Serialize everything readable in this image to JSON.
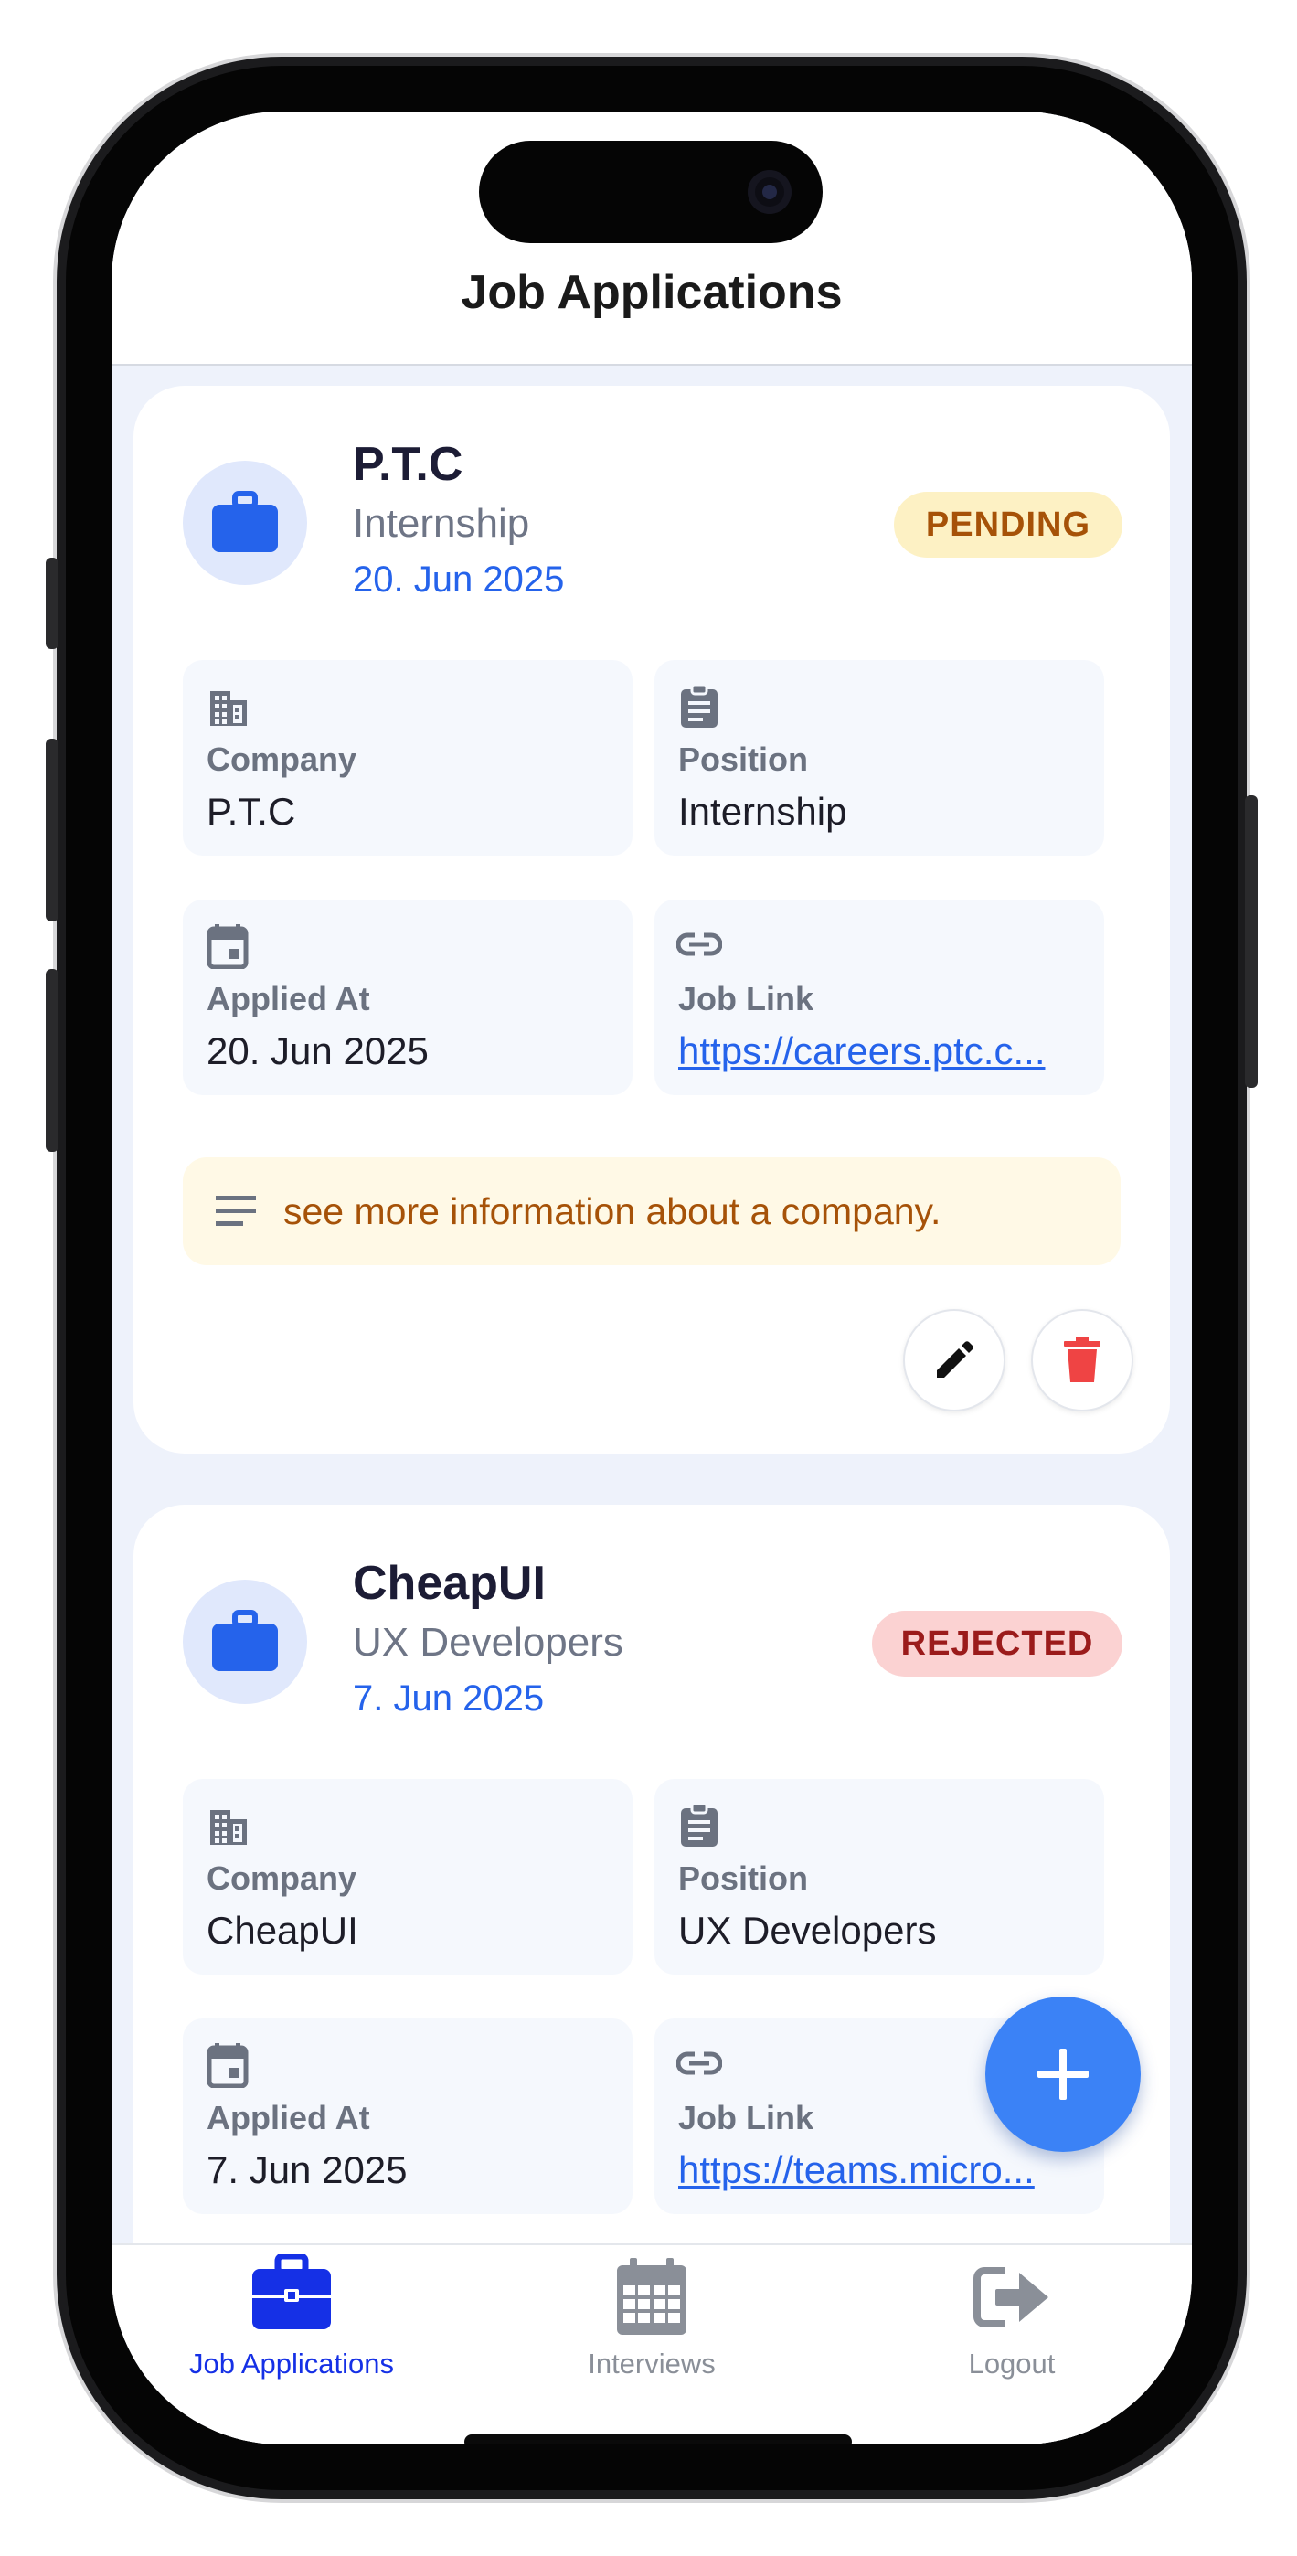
{
  "header": {
    "title": "Job Applications"
  },
  "applications": [
    {
      "company": "P.T.C",
      "position": "Internship",
      "date": "20. Jun 2025",
      "status": "PENDING",
      "details": {
        "company_label": "Company",
        "company_value": "P.T.C",
        "position_label": "Position",
        "position_value": "Internship",
        "applied_label": "Applied At",
        "applied_value": "20. Jun 2025",
        "link_label": "Job Link",
        "link_value": "https://careers.ptc.c..."
      },
      "note": "see more information about a company."
    },
    {
      "company": "CheapUI",
      "position": "UX Developers",
      "date": "7. Jun 2025",
      "status": "REJECTED",
      "details": {
        "company_label": "Company",
        "company_value": "CheapUI",
        "position_label": "Position",
        "position_value": "UX Developers",
        "applied_label": "Applied At",
        "applied_value": "7. Jun 2025",
        "link_label": "Job Link",
        "link_value": "https://teams.micro..."
      }
    }
  ],
  "nav": {
    "items": [
      {
        "label": "Job Applications",
        "icon": "briefcase-icon",
        "active": true
      },
      {
        "label": "Interviews",
        "icon": "calendar-icon",
        "active": false
      },
      {
        "label": "Logout",
        "icon": "logout-icon",
        "active": false
      }
    ]
  },
  "colors": {
    "accent": "#2563eb",
    "active_tab": "#1530e6",
    "fab": "#3b82f6",
    "pending_bg": "#fdf1c4",
    "pending_text": "#a65208",
    "rejected_bg": "#fbd2d2",
    "rejected_text": "#9b1b1b",
    "delete": "#ef4444"
  }
}
